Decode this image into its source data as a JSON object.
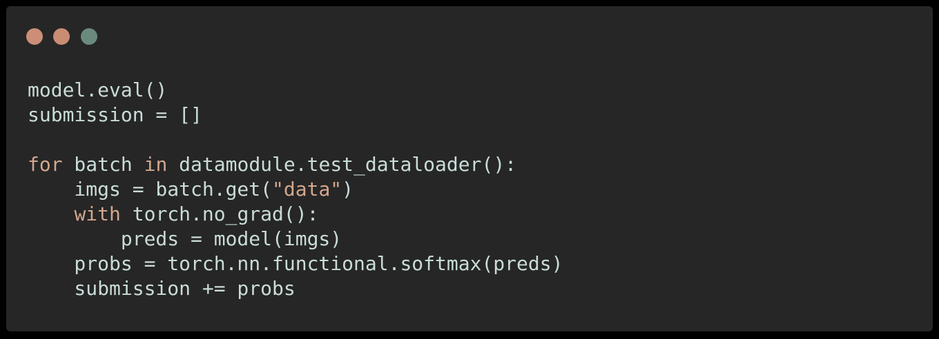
{
  "colors": {
    "background": "#000000",
    "window_background": "#262626",
    "close_dot": "#cd8e77",
    "minimize_dot": "#c98d73",
    "zoom_dot": "#6b8a7e",
    "default_text": "#c9dcd8",
    "keyword": "#d3a78e",
    "string": "#d3a78e"
  },
  "window_controls": [
    "close-icon",
    "minimize-icon",
    "zoom-icon"
  ],
  "code": {
    "language": "python",
    "lines": [
      [
        {
          "text": "model.eval()",
          "kind": "plain"
        }
      ],
      [
        {
          "text": "submission = []",
          "kind": "plain"
        }
      ],
      [],
      [
        {
          "text": "for",
          "kind": "keyword"
        },
        {
          "text": " batch ",
          "kind": "plain"
        },
        {
          "text": "in",
          "kind": "keyword"
        },
        {
          "text": " datamodule.test_dataloader():",
          "kind": "plain"
        }
      ],
      [
        {
          "text": "    imgs = batch.get(",
          "kind": "plain"
        },
        {
          "text": "\"data\"",
          "kind": "string"
        },
        {
          "text": ")",
          "kind": "plain"
        }
      ],
      [
        {
          "text": "    ",
          "kind": "plain"
        },
        {
          "text": "with",
          "kind": "keyword"
        },
        {
          "text": " torch.no_grad():",
          "kind": "plain"
        }
      ],
      [
        {
          "text": "        preds = model(imgs)",
          "kind": "plain"
        }
      ],
      [
        {
          "text": "    probs = torch.nn.functional.softmax(preds)",
          "kind": "plain"
        }
      ],
      [
        {
          "text": "    submission += probs",
          "kind": "plain"
        }
      ]
    ]
  }
}
